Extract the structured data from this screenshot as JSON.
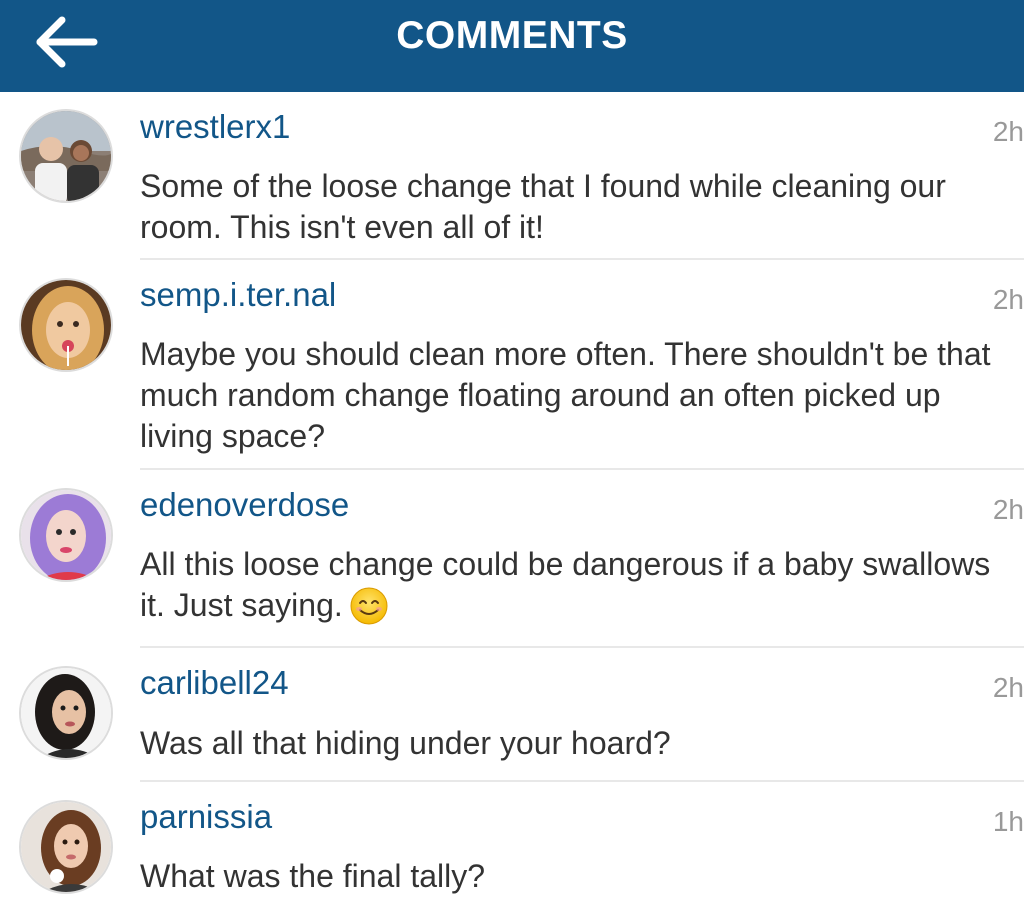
{
  "header": {
    "title": "COMMENTS",
    "back_icon": "arrow-left-icon",
    "background": "#125688"
  },
  "comments": [
    {
      "username": "wrestlerx1",
      "time": "2h",
      "text": "Some of the loose change that I found while cleaning our room. This isn't even all of it!",
      "avatar": "avatar-photo-two-people"
    },
    {
      "username": "semp.i.ter.nal",
      "time": "2h",
      "text": "Maybe you should clean more often. There shouldn't be that much random change floating around an often picked up living space?",
      "avatar": "avatar-photo-woman-blonde"
    },
    {
      "username": "edenoverdose",
      "time": "2h",
      "text": "All this loose change could be dangerous if a baby swallows it. Just saying.",
      "emoji": "smiling-face-emoji",
      "avatar": "avatar-photo-woman-purple-hair"
    },
    {
      "username": "carlibell24",
      "time": "2h",
      "text": "Was all that hiding under your hoard?",
      "avatar": "avatar-photo-woman-dark-hair"
    },
    {
      "username": "parnissia",
      "time": "1h",
      "text": "What was the final tally?",
      "avatar": "avatar-photo-woman-brown-hair"
    }
  ],
  "colors": {
    "username": "#125688",
    "time": "#999999",
    "text": "#333333",
    "divider": "#e8e8e8"
  }
}
